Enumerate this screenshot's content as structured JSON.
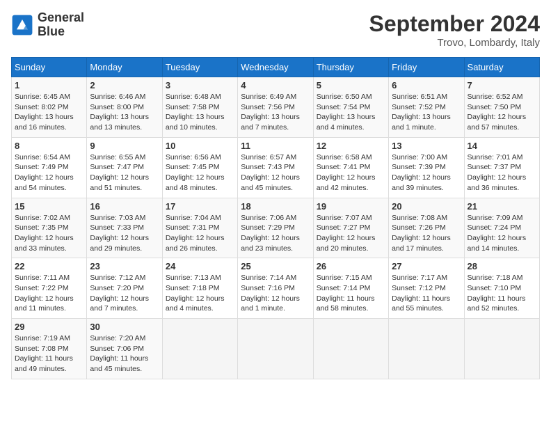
{
  "header": {
    "logo_line1": "General",
    "logo_line2": "Blue",
    "month_title": "September 2024",
    "location": "Trovo, Lombardy, Italy"
  },
  "days_of_week": [
    "Sunday",
    "Monday",
    "Tuesday",
    "Wednesday",
    "Thursday",
    "Friday",
    "Saturday"
  ],
  "weeks": [
    [
      {
        "day": "1",
        "info": "Sunrise: 6:45 AM\nSunset: 8:02 PM\nDaylight: 13 hours and 16 minutes."
      },
      {
        "day": "2",
        "info": "Sunrise: 6:46 AM\nSunset: 8:00 PM\nDaylight: 13 hours and 13 minutes."
      },
      {
        "day": "3",
        "info": "Sunrise: 6:48 AM\nSunset: 7:58 PM\nDaylight: 13 hours and 10 minutes."
      },
      {
        "day": "4",
        "info": "Sunrise: 6:49 AM\nSunset: 7:56 PM\nDaylight: 13 hours and 7 minutes."
      },
      {
        "day": "5",
        "info": "Sunrise: 6:50 AM\nSunset: 7:54 PM\nDaylight: 13 hours and 4 minutes."
      },
      {
        "day": "6",
        "info": "Sunrise: 6:51 AM\nSunset: 7:52 PM\nDaylight: 13 hours and 1 minute."
      },
      {
        "day": "7",
        "info": "Sunrise: 6:52 AM\nSunset: 7:50 PM\nDaylight: 12 hours and 57 minutes."
      }
    ],
    [
      {
        "day": "8",
        "info": "Sunrise: 6:54 AM\nSunset: 7:49 PM\nDaylight: 12 hours and 54 minutes."
      },
      {
        "day": "9",
        "info": "Sunrise: 6:55 AM\nSunset: 7:47 PM\nDaylight: 12 hours and 51 minutes."
      },
      {
        "day": "10",
        "info": "Sunrise: 6:56 AM\nSunset: 7:45 PM\nDaylight: 12 hours and 48 minutes."
      },
      {
        "day": "11",
        "info": "Sunrise: 6:57 AM\nSunset: 7:43 PM\nDaylight: 12 hours and 45 minutes."
      },
      {
        "day": "12",
        "info": "Sunrise: 6:58 AM\nSunset: 7:41 PM\nDaylight: 12 hours and 42 minutes."
      },
      {
        "day": "13",
        "info": "Sunrise: 7:00 AM\nSunset: 7:39 PM\nDaylight: 12 hours and 39 minutes."
      },
      {
        "day": "14",
        "info": "Sunrise: 7:01 AM\nSunset: 7:37 PM\nDaylight: 12 hours and 36 minutes."
      }
    ],
    [
      {
        "day": "15",
        "info": "Sunrise: 7:02 AM\nSunset: 7:35 PM\nDaylight: 12 hours and 33 minutes."
      },
      {
        "day": "16",
        "info": "Sunrise: 7:03 AM\nSunset: 7:33 PM\nDaylight: 12 hours and 29 minutes."
      },
      {
        "day": "17",
        "info": "Sunrise: 7:04 AM\nSunset: 7:31 PM\nDaylight: 12 hours and 26 minutes."
      },
      {
        "day": "18",
        "info": "Sunrise: 7:06 AM\nSunset: 7:29 PM\nDaylight: 12 hours and 23 minutes."
      },
      {
        "day": "19",
        "info": "Sunrise: 7:07 AM\nSunset: 7:27 PM\nDaylight: 12 hours and 20 minutes."
      },
      {
        "day": "20",
        "info": "Sunrise: 7:08 AM\nSunset: 7:26 PM\nDaylight: 12 hours and 17 minutes."
      },
      {
        "day": "21",
        "info": "Sunrise: 7:09 AM\nSunset: 7:24 PM\nDaylight: 12 hours and 14 minutes."
      }
    ],
    [
      {
        "day": "22",
        "info": "Sunrise: 7:11 AM\nSunset: 7:22 PM\nDaylight: 12 hours and 11 minutes."
      },
      {
        "day": "23",
        "info": "Sunrise: 7:12 AM\nSunset: 7:20 PM\nDaylight: 12 hours and 7 minutes."
      },
      {
        "day": "24",
        "info": "Sunrise: 7:13 AM\nSunset: 7:18 PM\nDaylight: 12 hours and 4 minutes."
      },
      {
        "day": "25",
        "info": "Sunrise: 7:14 AM\nSunset: 7:16 PM\nDaylight: 12 hours and 1 minute."
      },
      {
        "day": "26",
        "info": "Sunrise: 7:15 AM\nSunset: 7:14 PM\nDaylight: 11 hours and 58 minutes."
      },
      {
        "day": "27",
        "info": "Sunrise: 7:17 AM\nSunset: 7:12 PM\nDaylight: 11 hours and 55 minutes."
      },
      {
        "day": "28",
        "info": "Sunrise: 7:18 AM\nSunset: 7:10 PM\nDaylight: 11 hours and 52 minutes."
      }
    ],
    [
      {
        "day": "29",
        "info": "Sunrise: 7:19 AM\nSunset: 7:08 PM\nDaylight: 11 hours and 49 minutes."
      },
      {
        "day": "30",
        "info": "Sunrise: 7:20 AM\nSunset: 7:06 PM\nDaylight: 11 hours and 45 minutes."
      },
      {
        "day": "",
        "info": ""
      },
      {
        "day": "",
        "info": ""
      },
      {
        "day": "",
        "info": ""
      },
      {
        "day": "",
        "info": ""
      },
      {
        "day": "",
        "info": ""
      }
    ]
  ]
}
